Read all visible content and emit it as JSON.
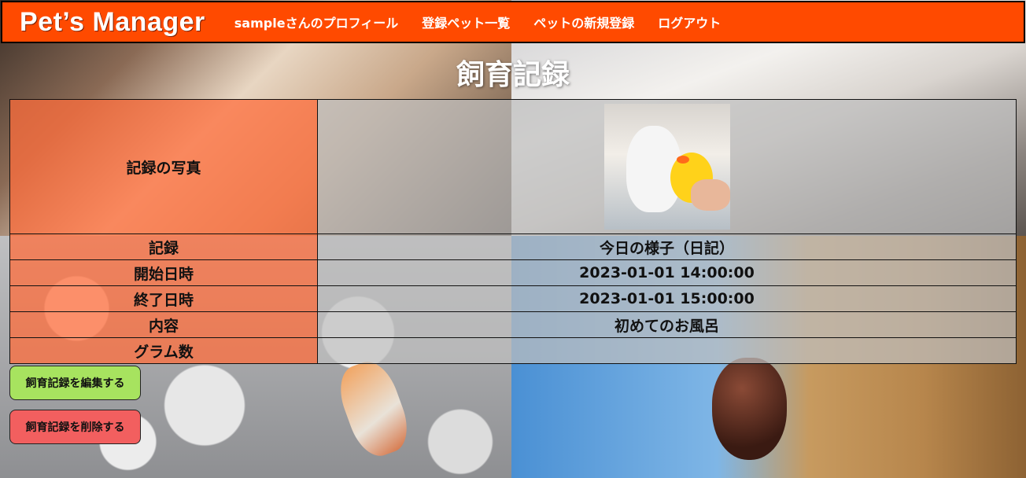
{
  "header": {
    "brand": "Pet’s Manager",
    "nav": [
      {
        "label": "sampleさんのプロフィール"
      },
      {
        "label": "登録ペット一覧"
      },
      {
        "label": "ペットの新規登録"
      },
      {
        "label": "ログアウト"
      }
    ]
  },
  "page_title": "飼育記録",
  "record": {
    "rows": [
      {
        "label": "記録の写真",
        "value": ""
      },
      {
        "label": "記録",
        "value": "今日の様子（日記）"
      },
      {
        "label": "開始日時",
        "value": "2023-01-01 14:00:00"
      },
      {
        "label": "終了日時",
        "value": "2023-01-01 15:00:00"
      },
      {
        "label": "内容",
        "value": "初めてのお風呂"
      },
      {
        "label": "グラム数",
        "value": ""
      }
    ]
  },
  "actions": {
    "edit_label": "飼育記録を編集する",
    "delete_label": "飼育記録を削除する"
  },
  "colors": {
    "header_bg": "#ff4a00",
    "label_cell": "#ff6e3c",
    "edit_button": "#a7e35f",
    "delete_button": "#f25f5f"
  }
}
